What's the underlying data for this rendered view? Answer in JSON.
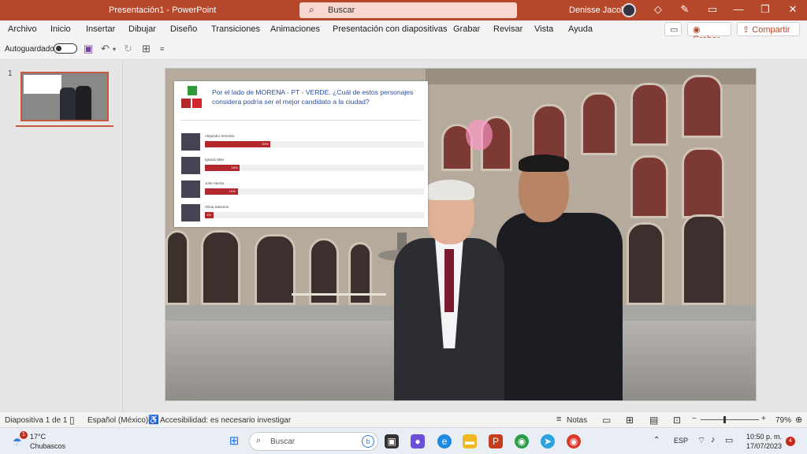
{
  "titlebar": {
    "title": "Presentación1  -  PowerPoint",
    "search_placeholder": "Buscar",
    "user": "Denisse Jacobo"
  },
  "menu": {
    "items": [
      "Archivo",
      "Inicio",
      "Insertar",
      "Dibujar",
      "Diseño",
      "Transiciones",
      "Animaciones",
      "Presentación con diapositivas",
      "Grabar",
      "Revisar",
      "Vista",
      "Ayuda"
    ],
    "grabar_btn": "Grabar",
    "compartir_btn": "Compartir"
  },
  "toolbar": {
    "autosave_label": "Autoguardado"
  },
  "thumbnails": {
    "number": "1"
  },
  "poll": {
    "question": "Por el lado de MORENA - PT - VERDE. ¿Cuál de estos personajes considera podría ser el mejor candidato a la ciudad?",
    "candidates": [
      {
        "name": "Alejandro Armenta",
        "percent": 30,
        "label": "30%"
      },
      {
        "name": "Ignacio Mier",
        "percent": 16,
        "label": "16%"
      },
      {
        "name": "Julio Huerta",
        "percent": 15,
        "label": "15%"
      },
      {
        "name": "Olivia Salomón",
        "percent": 4,
        "label": "4%"
      }
    ]
  },
  "statusbar": {
    "slide": "Diapositiva 1 de 1",
    "language": "Español (México)",
    "accessibility": "Accesibilidad: es necesario investigar",
    "notes": "Notas",
    "zoom": "79%"
  },
  "taskbar": {
    "temp": "17°C",
    "condition": "Chubascos",
    "search": "Buscar",
    "lang": "ESP",
    "time": "10:50 p. m.",
    "date": "17/07/2023",
    "notifications": "4",
    "weather_badge": "1"
  }
}
